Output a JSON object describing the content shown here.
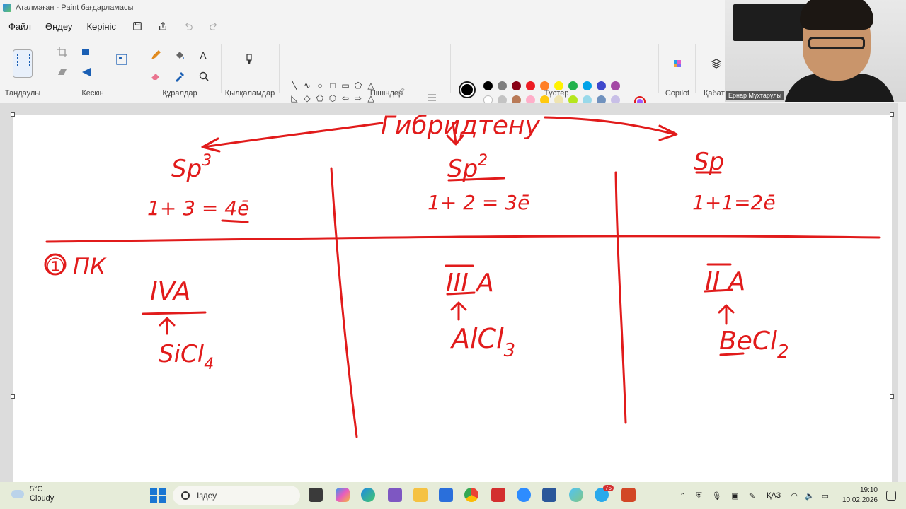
{
  "window": {
    "title": "Аталмаған - Paint бағдарламасы"
  },
  "menu": {
    "file": "Файл",
    "edit": "Өңдеу",
    "view": "Көрініс"
  },
  "ribbon": {
    "groups": {
      "selection": "Таңдаулы",
      "image": "Кескін",
      "tools": "Құралдар",
      "brushes": "Қылқаламдар",
      "shapes": "Пішіндер",
      "colors": "Түстер",
      "copilot": "Copilot",
      "layers": "Қабаттар"
    },
    "shape_glyphs": [
      "╲",
      "∿",
      "○",
      "□",
      "▭",
      "⬠",
      "△",
      "◺",
      "◇",
      "⬠",
      "⬡",
      "⇦",
      "⇨",
      "△",
      "⇩",
      "✧",
      "☆",
      "▢",
      "◯",
      "◌",
      "✡",
      "⌒"
    ],
    "palette_row1": [
      "#000000",
      "#7f7f7f",
      "#880015",
      "#ed1c24",
      "#ff7f27",
      "#fff200",
      "#22b14c",
      "#00a2e8",
      "#3f48cc",
      "#a349a4"
    ],
    "palette_row2": [
      "#ffffff",
      "#c3c3c3",
      "#b97a57",
      "#ffaec9",
      "#ffc90e",
      "#efe4b0",
      "#b5e61d",
      "#99d9ea",
      "#7092be",
      "#c8bfe7"
    ],
    "current_color": "#000000",
    "secondary_color": "#ffffff"
  },
  "webcam": {
    "name": "Ернар Мұхтарұлы"
  },
  "drawing": {
    "ink_color": "#e11b1b",
    "heading": "Гибридтену",
    "sp3": {
      "label": "Sp",
      "exp": "3",
      "formula": "1+ 3 = 4ē"
    },
    "sp2": {
      "label": "Sp",
      "exp": "2",
      "formula": "1+ 2 = 3ē"
    },
    "sp": {
      "label": "Sp",
      "formula": "1+1=2ē"
    },
    "row_label": "① ПК",
    "col1": {
      "group": "IVA",
      "compound": "SiCl",
      "sub": "4"
    },
    "col2": {
      "group": "III A",
      "compound": "AlCl",
      "sub": "3"
    },
    "col3": {
      "group": "II A",
      "compound": "BeCl",
      "sub": "2"
    }
  },
  "taskbar": {
    "weather_temp": "5°C",
    "weather_desc": "Cloudy",
    "search_placeholder": "Іздеу",
    "language": "ҚАЗ",
    "time": "19:10",
    "date": "10.02.2026",
    "teams_badge": "75"
  }
}
